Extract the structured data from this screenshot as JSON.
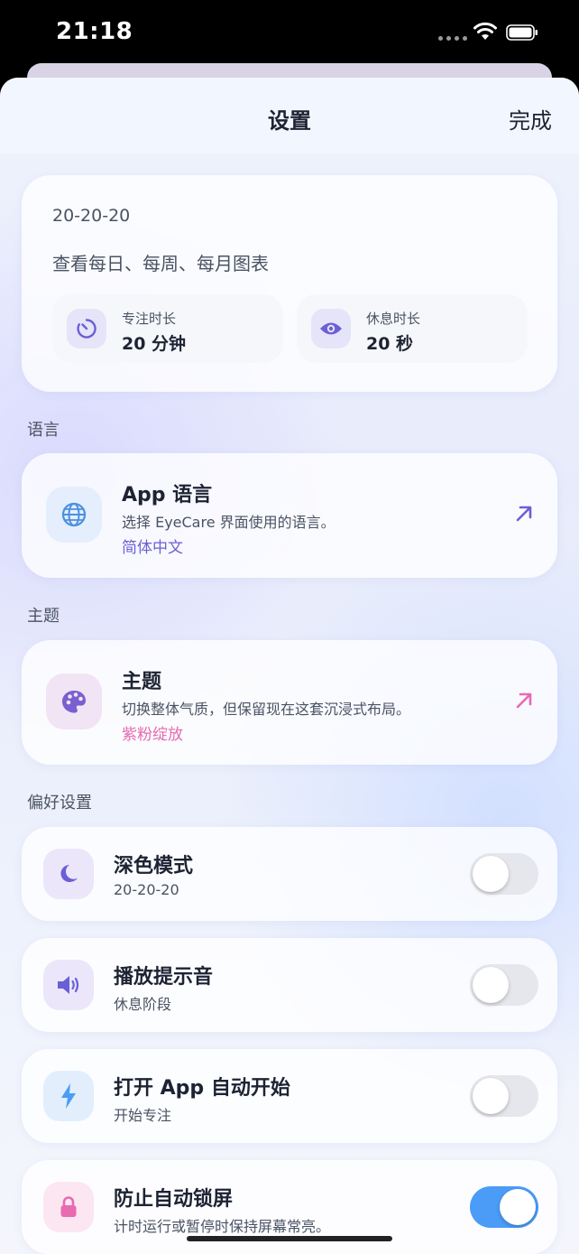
{
  "status_bar": {
    "time": "21:18"
  },
  "nav": {
    "title": "设置",
    "done_label": "完成"
  },
  "summary": {
    "title": "20-20-20",
    "charts_link": "查看每日、每周、每月图表",
    "focus": {
      "label": "专注时长",
      "value": "20 分钟",
      "icon": "timer-icon"
    },
    "rest": {
      "label": "休息时长",
      "value": "20 秒",
      "icon": "eye-icon"
    }
  },
  "language_section": {
    "label": "语言",
    "title": "App 语言",
    "description": "选择 EyeCare 界面使用的语言。",
    "value": "简体中文",
    "icon": "globe-icon",
    "accent": "#6b5fd6"
  },
  "theme_section": {
    "label": "主题",
    "title": "主题",
    "description": "切换整体气质，但保留现在这套沉浸式布局。",
    "value": "紫粉绽放",
    "icon": "palette-icon",
    "accent": "#e86ab0"
  },
  "preferences": {
    "label": "偏好设置",
    "items": [
      {
        "title": "深色模式",
        "subtitle": "20-20-20",
        "icon": "moon-icon",
        "enabled": false
      },
      {
        "title": "播放提示音",
        "subtitle": "休息阶段",
        "icon": "speaker-icon",
        "enabled": false
      },
      {
        "title": "打开 App 自动开始",
        "subtitle": "开始专注",
        "icon": "lightning-icon",
        "enabled": false
      },
      {
        "title": "防止自动锁屏",
        "subtitle": "计时运行或暂停时保持屏幕常亮。",
        "icon": "lock-icon",
        "enabled": true
      }
    ]
  },
  "colors": {
    "primary_text": "#1d2333",
    "secondary_text": "#4a5363",
    "purple_accent": "#6b5fd6",
    "pink_accent": "#e86ab0",
    "toggle_on": "#4a9cf6"
  }
}
